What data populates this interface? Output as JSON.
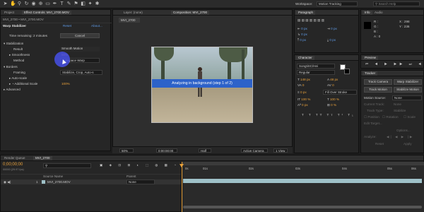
{
  "toolbar": {
    "workspace_label": "Workspace:",
    "workspace_value": "Motion Tracking",
    "search_placeholder": "Search Help"
  },
  "left_panel": {
    "tabs": [
      "Project",
      "Effect Controls: MVI_2700.MOV"
    ],
    "breadcrumb": "MVI_2700 • MVI_2700.MOV",
    "effect_name": "Warp Stabilizer",
    "reset_label": "Reset",
    "about_label": "About...",
    "time_remaining": "Time remaining: 2 minutes",
    "cancel_label": "Cancel",
    "stabilization_label": "Stabilization",
    "result_label": "Result",
    "result_value": "Smooth Motion",
    "smoothness_label": "Smoothness",
    "smoothness_value": "50%",
    "method_label": "Method",
    "method_value": "Subspace Warp",
    "borders_label": "Borders",
    "framing_label": "Framing",
    "framing_value": "Stabilize, Crop, Auto-s",
    "autoscale_label": "Auto-scale",
    "additional_scale_label": "Additional Scale",
    "additional_scale_value": "100%",
    "advanced_label": "Advanced"
  },
  "comp_panel": {
    "tabs": [
      "Layer: (none)",
      "Composition: MVI_2700"
    ],
    "breadcrumb": "MVI_2700",
    "analyzing_text": "Analyzing in background (step 1 of 2)",
    "zoom_value": "50%",
    "timecode": "0;00;00;00",
    "resolution": "Half",
    "camera": "Active Camera",
    "views": "1 View"
  },
  "info_panel": {
    "tabs": [
      "Info",
      "Audio"
    ],
    "x_readout": "X : 298",
    "y_readout": "Y : 236",
    "r_readout": "R :",
    "g_readout": "G :",
    "b_readout": "B :",
    "a_readout": "A : 0"
  },
  "preview_panel": {
    "tabs": [
      "Preview"
    ]
  },
  "paragraph_panel": {
    "tabs": [
      "Paragraph"
    ]
  },
  "character_panel": {
    "tabs": [
      "Character"
    ],
    "font_name": "SongtiSC/Hei",
    "font_style": "Regular",
    "size_value": "148 px",
    "leading_value": "48 px",
    "tracking_value": "0",
    "stroke_value": "0 px",
    "stroke_option": "Fill Over Stroke",
    "vscale": "100 %",
    "hscale": "100 %",
    "baseline": "0 px",
    "tsume": "0 %"
  },
  "tracker_panel": {
    "tabs": [
      "Tracker"
    ],
    "track_camera": "Track Camera",
    "warp_stabilizer": "Warp Stabilizer",
    "track_motion": "Track Motion",
    "stabilize_motion": "Stabilize Motion",
    "motion_source_label": "Motion Source:",
    "motion_source_value": "None",
    "current_track_label": "Current Track:",
    "current_track_value": "None",
    "track_type_label": "Track Type:",
    "track_type_value": "Stabilize",
    "position_label": "Position",
    "rotation_label": "Rotation",
    "scale_label": "Scale",
    "edit_target_label": "Edit Target...",
    "options_label": "Options...",
    "analyze_label": "Analyze:",
    "reset_label": "Reset",
    "apply_label": "Apply"
  },
  "timeline": {
    "tabs": [
      "Render Queue",
      "MVI_2700"
    ],
    "timecode": "0;00;00;00",
    "timecode_sub": "00000 (29.97 fps)",
    "col_source": "Source Name",
    "col_parent": "Parent",
    "layer_num": "1",
    "layer_name": "MVI_2700.MOV",
    "layer_parent": "None",
    "ruler": [
      "0s",
      "01s",
      "02s",
      "03s",
      "04s",
      "05s",
      "06s"
    ],
    "colors": {
      "track": "#9fc1c8",
      "playhead": "#e8a13b",
      "accent": "#5f9be8"
    }
  }
}
